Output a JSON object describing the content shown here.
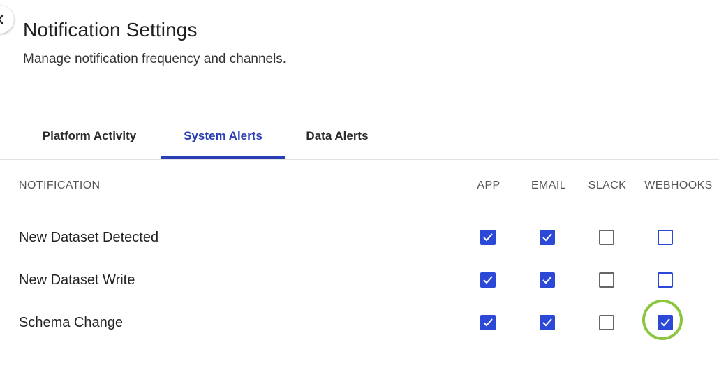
{
  "header": {
    "title": "Notification Settings",
    "subtitle": "Manage notification frequency and channels."
  },
  "tabs": [
    {
      "label": "Platform Activity",
      "active": false
    },
    {
      "label": "System Alerts",
      "active": true
    },
    {
      "label": "Data Alerts",
      "active": false
    }
  ],
  "table": {
    "columns": {
      "notification": "NOTIFICATION",
      "app": "APP",
      "email": "EMAIL",
      "slack": "SLACK",
      "webhooks": "WEBHOOKS"
    },
    "rows": [
      {
        "label": "New Dataset Detected",
        "app": true,
        "email": true,
        "slack": false,
        "webhooks": false
      },
      {
        "label": "New Dataset Write",
        "app": true,
        "email": true,
        "slack": false,
        "webhooks": false
      },
      {
        "label": "Schema Change",
        "app": true,
        "email": true,
        "slack": false,
        "webhooks": true
      }
    ]
  },
  "colors": {
    "accent": "#2a3fb5",
    "checkbox_checked": "#2b48d6",
    "highlight_ring": "#8cc63f"
  },
  "icons": {
    "back": "chevron-left-icon",
    "check": "checkmark-icon"
  }
}
